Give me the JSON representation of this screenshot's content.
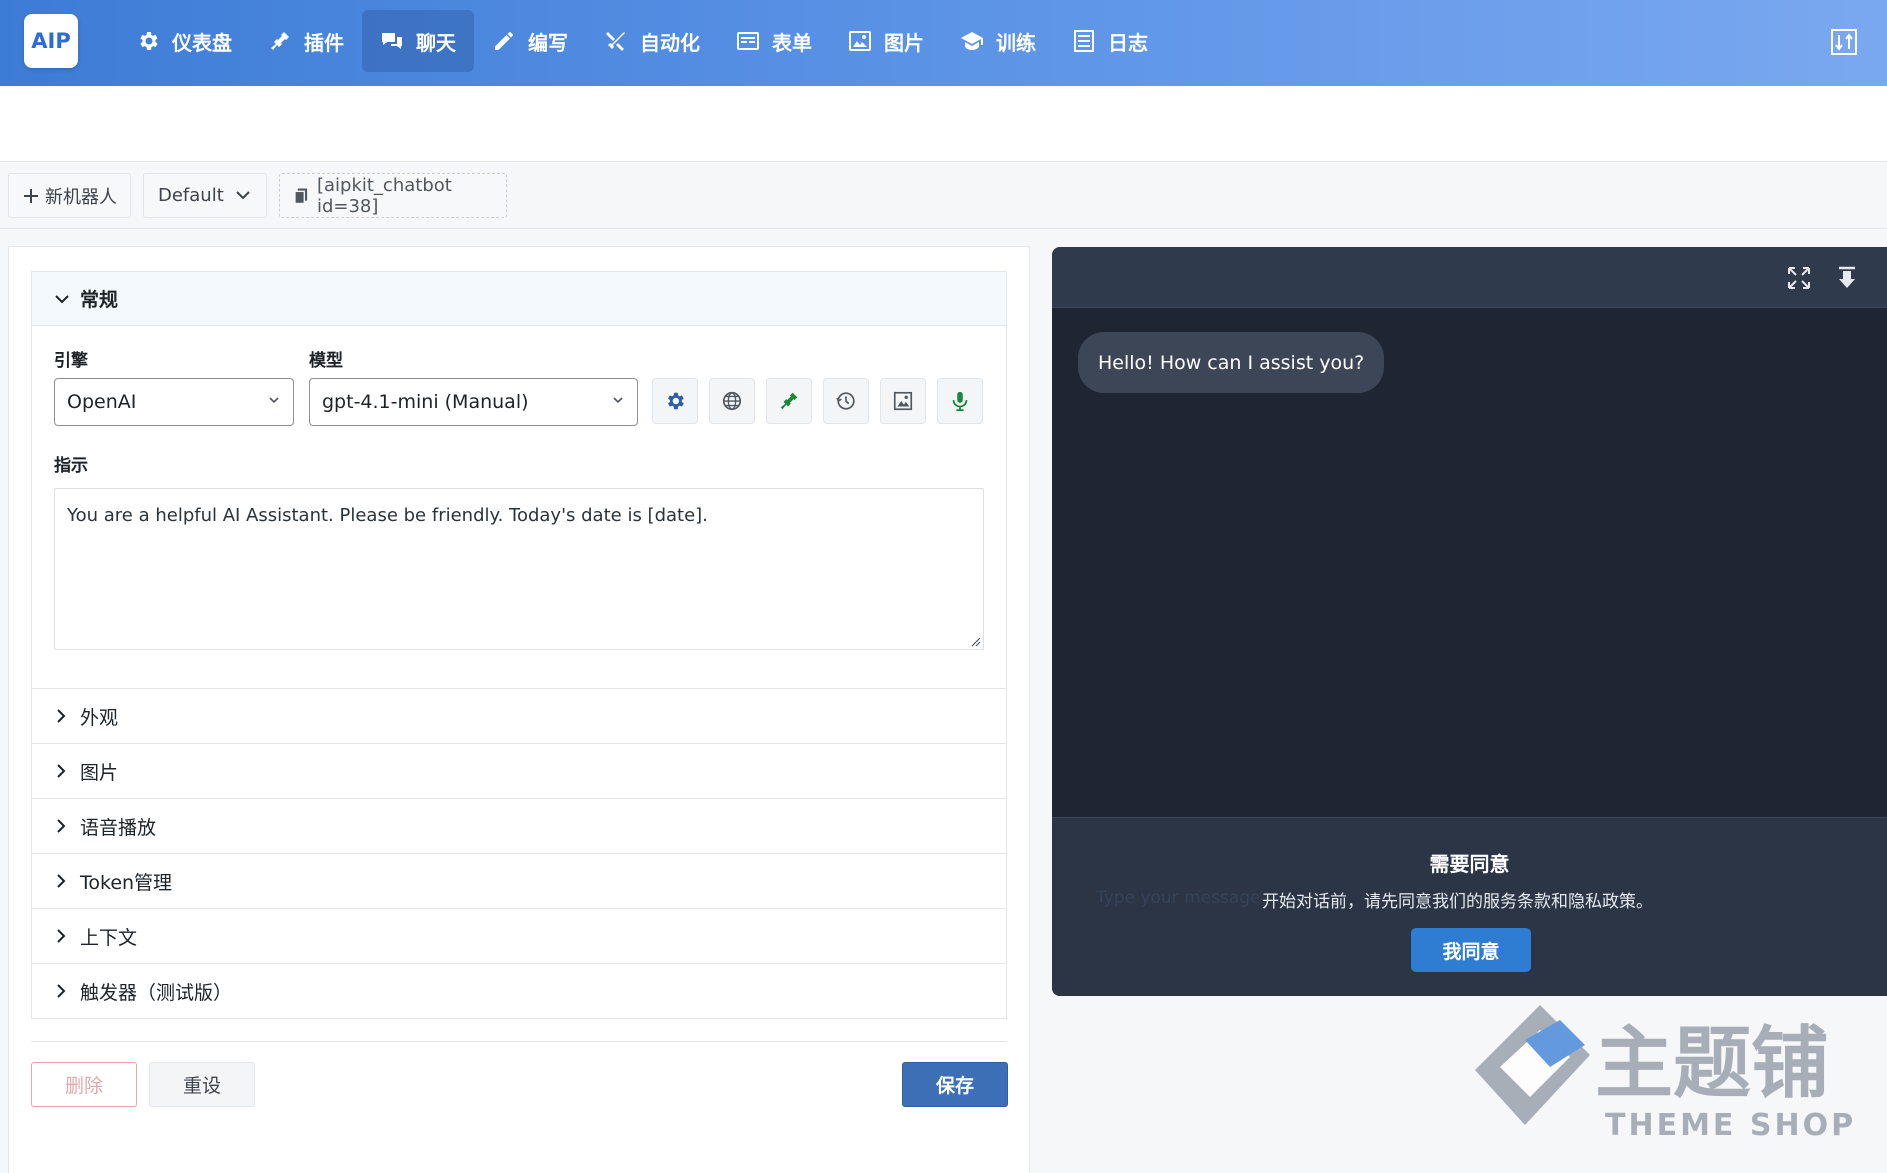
{
  "app": {
    "logo_text": "AIP",
    "brand_color": "#3d7cd6"
  },
  "nav": {
    "items": [
      {
        "label": "仪表盘",
        "icon": "gear-icon",
        "active": false
      },
      {
        "label": "插件",
        "icon": "plug-icon",
        "active": false
      },
      {
        "label": "聊天",
        "icon": "chat-icon",
        "active": true
      },
      {
        "label": "编写",
        "icon": "pencil-icon",
        "active": false
      },
      {
        "label": "自动化",
        "icon": "tools-icon",
        "active": false
      },
      {
        "label": "表单",
        "icon": "form-icon",
        "active": false
      },
      {
        "label": "图片",
        "icon": "image-icon",
        "active": false
      },
      {
        "label": "训练",
        "icon": "graduation-cap-icon",
        "active": false
      },
      {
        "label": "日志",
        "icon": "list-icon",
        "active": false
      }
    ]
  },
  "toolbar": {
    "new_bot_label": "新机器人",
    "bot_select_value": "Default",
    "shortcode": "[aipkit_chatbot id=38]"
  },
  "general": {
    "section_title": "常规",
    "engine_label": "引擎",
    "engine_value": "OpenAI",
    "model_label": "模型",
    "model_value": "gpt-4.1-mini (Manual)",
    "instructions_label": "指示",
    "instructions_value": "You are a helpful AI Assistant. Please be friendly. Today's date is [date]."
  },
  "sections": [
    {
      "label": "外观"
    },
    {
      "label": "图片"
    },
    {
      "label": "语音播放"
    },
    {
      "label": "Token管理"
    },
    {
      "label": "上下文"
    },
    {
      "label": "触发器（测试版）"
    }
  ],
  "actions": {
    "delete_label": "删除",
    "reset_label": "重设",
    "save_label": "保存"
  },
  "chat": {
    "greeting": "Hello! How can I assist you?",
    "consent_title": "需要同意",
    "consent_ghost": "Type your message",
    "consent_text": "开始对话前，请先同意我们的服务条款和隐私政策。",
    "consent_button": "我同意"
  },
  "watermark": {
    "title": "主题铺",
    "subtitle": "THEME SHOP"
  }
}
